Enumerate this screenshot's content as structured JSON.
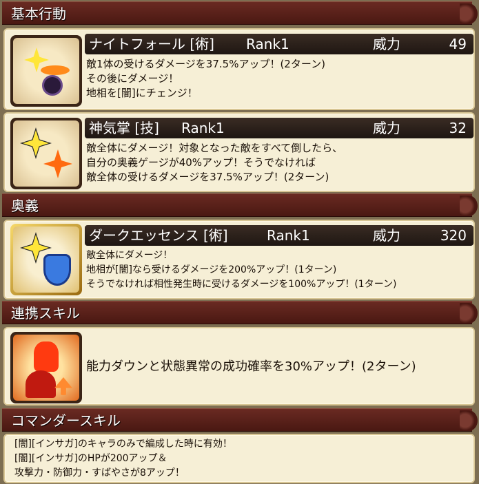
{
  "sections": {
    "basic": "基本行動",
    "ougi": "奥義",
    "renkei": "連携スキル",
    "commander": "コマンダースキル"
  },
  "skills": [
    {
      "name": "ナイトフォール [術]",
      "rank": "Rank1",
      "power_label": "威力",
      "power": "49",
      "lines": [
        "敵1体の受けるダメージを37.5%アップ！(2ターン)",
        "その後にダメージ！",
        "地相を[闇]にチェンジ！"
      ]
    },
    {
      "name": "神気掌 [技]",
      "rank": "Rank1",
      "power_label": "威力",
      "power": "32",
      "lines": [
        "敵全体にダメージ！対象となった敵をすべて倒したら、",
        "自分の奥義ゲージが40%アップ！そうでなければ",
        "敵全体の受けるダメージを37.5%アップ！(2ターン)"
      ]
    },
    {
      "name": "ダークエッセンス [術]",
      "rank": "Rank1",
      "power_label": "威力",
      "power": "320",
      "lines": [
        "敵全体にダメージ！",
        "地相が[闇]なら受けるダメージを200%アップ！(1ターン)",
        "そうでなければ相性発生時に受けるダメージを100%アップ！(1ターン)"
      ]
    }
  ],
  "renkei": {
    "text": "能力ダウンと状態異常の成功確率を30%アップ！(2ターン)"
  },
  "commander": {
    "lines": [
      "[闇][インサガ]のキャラのみで編成した時に有効！",
      "[闇][インサガ]のHPが200アップ＆",
      "攻撃力・防御力・すばやさが8アップ！"
    ]
  },
  "colors": {
    "header_bg": "#5a1f18",
    "card_bg": "#f6efd6",
    "titlebar_bg": "#2a1e18"
  }
}
